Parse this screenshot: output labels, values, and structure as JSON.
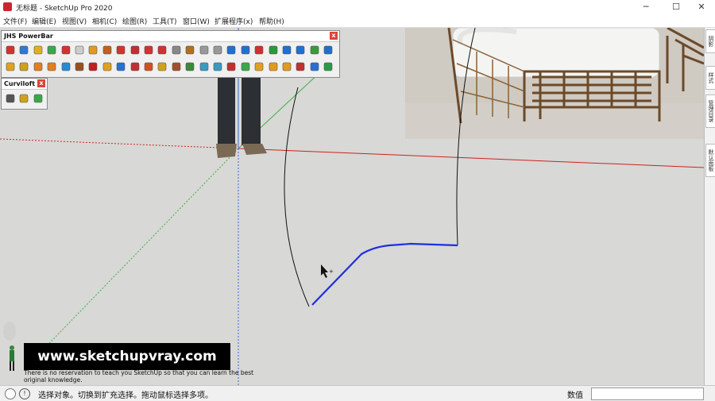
{
  "window": {
    "title": "无标题 - SketchUp Pro 2020",
    "minimize": "─",
    "maximize": "☐",
    "close": "✕"
  },
  "menu": [
    "文件(F)",
    "编辑(E)",
    "视图(V)",
    "相机(C)",
    "绘图(R)",
    "工具(T)",
    "窗口(W)",
    "扩展程序(x)",
    "帮助(H)"
  ],
  "powerbar": {
    "title": "JHS PowerBar",
    "close": "x",
    "row1_colors": [
      "#d0342c",
      "#2b7bd6",
      "#e0b020",
      "#3aa84a",
      "#d0342c",
      "#cccccc",
      "#e09a20",
      "#c06020",
      "#d0342c",
      "#c03030",
      "#d0342c",
      "#cc3333",
      "#888888",
      "#b07020",
      "#999999",
      "#999999",
      "#2070d0",
      "#2070d0",
      "#d03030",
      "#2a9a3a",
      "#2070d0",
      "#2070d0",
      "#3a9a3a",
      "#2070d0"
    ],
    "row2_colors": [
      "#e0a020",
      "#d0a020",
      "#e08020",
      "#e08020",
      "#2a8ad0",
      "#9a5020",
      "#c02020",
      "#e0a020",
      "#2a70d0",
      "#c03030",
      "#d05020",
      "#d0a020",
      "#a05030",
      "#3a8a3a",
      "#3a9ac0",
      "#3a9ac0",
      "#c03030",
      "#3aa84a",
      "#e0a020",
      "#e09a20",
      "#e09a20",
      "#c03030",
      "#2a70d0",
      "#2a9a4a"
    ]
  },
  "curviloft": {
    "title": "Curviloft",
    "close": "x",
    "tools": [
      "#555555",
      "#d0a020",
      "#3aa84a"
    ]
  },
  "tray_tabs": [
    "阴影",
    "样式",
    "管理目录",
    "默认面板"
  ],
  "watermark": {
    "url": "www.sketchupvray.com",
    "note": "There is no reservation to teach you SketchUp so that you can learn the best original knowledge."
  },
  "statusbar": {
    "text": "选择对象。切换到扩充选择。拖动鼠标选择多项。",
    "vcb_label": "数值",
    "vcb_value": ""
  },
  "colors": {
    "axis_red": "#cc2222",
    "axis_green": "#3cb043",
    "axis_blue": "#3a6ad8",
    "selected_curve": "#1f2fe0"
  }
}
